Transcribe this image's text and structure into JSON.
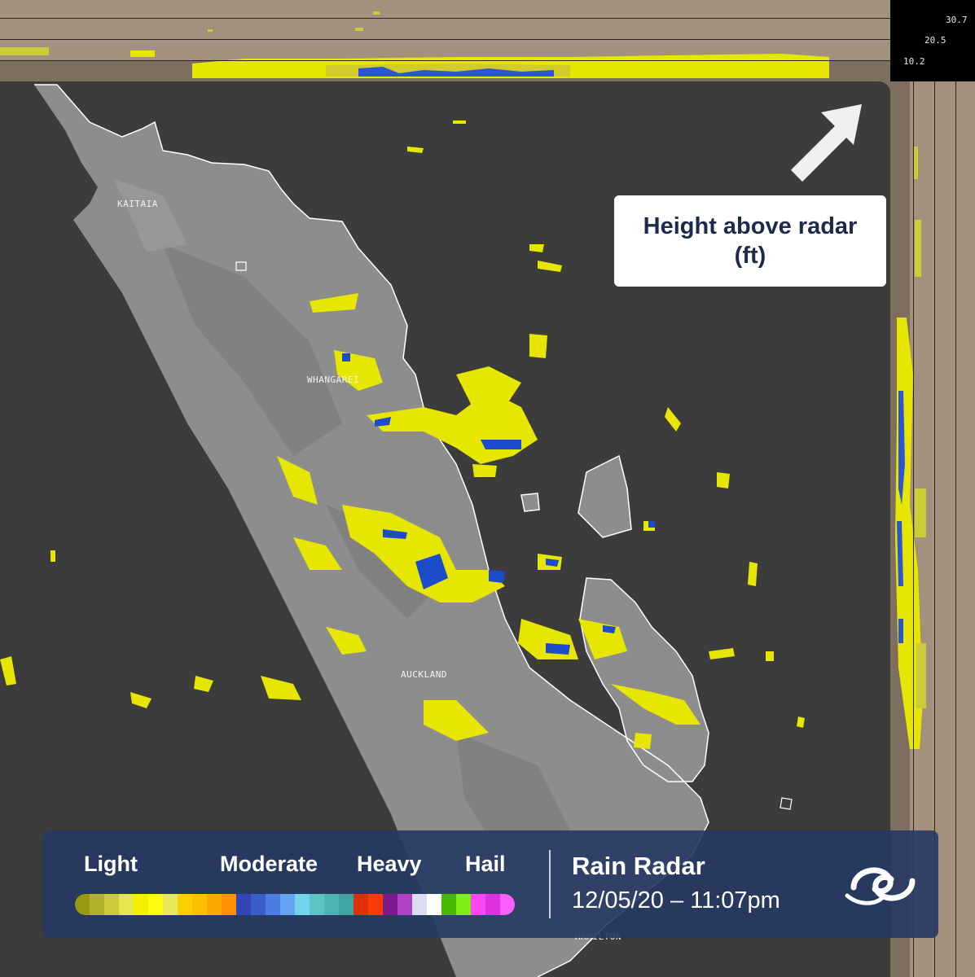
{
  "scale": {
    "labels": [
      "30.7",
      "20.5",
      "10.2"
    ]
  },
  "places": [
    {
      "id": "kaitaia",
      "name": "KAITAIA"
    },
    {
      "id": "whangarei",
      "name": "WHANGAREI"
    },
    {
      "id": "auckland",
      "name": "AUCKLAND"
    },
    {
      "id": "hamilton",
      "name": "HAMILTON"
    }
  ],
  "annotation": {
    "text": "Height above radar (ft)"
  },
  "legend": {
    "categories": [
      "Light",
      "Moderate",
      "Heavy",
      "Hail"
    ],
    "colors": [
      "#9a9a10",
      "#b2b22a",
      "#cccc38",
      "#e6e650",
      "#f4f000",
      "#fcfc10",
      "#e8e85a",
      "#fcd000",
      "#fcc000",
      "#fca800",
      "#fc9000",
      "#3444b4",
      "#3c5ccc",
      "#4c7ce4",
      "#64a4f4",
      "#74d4ec",
      "#5cc4c4",
      "#4cb4b4",
      "#40a4a0",
      "#e03008",
      "#fc3c08",
      "#7c1c8c",
      "#b040c4",
      "#dcdcf4",
      "#ffffff",
      "#48b800",
      "#80ec18",
      "#fc48f4",
      "#e030e0",
      "#fc60fc"
    ],
    "title": "Rain Radar",
    "timestamp": "12/05/20 – 11:07pm"
  },
  "colors": {
    "legend_bg": "#263864",
    "panel_tan": "#a3907d",
    "land": "#8c8c8c",
    "sea": "#3c3c3c",
    "echo_light": "#e6e600",
    "echo_moderate": "#1a4ccc"
  }
}
